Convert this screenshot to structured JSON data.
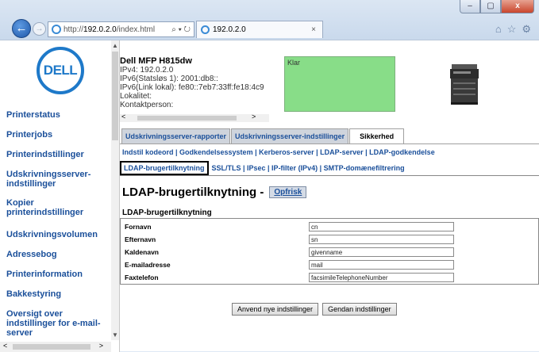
{
  "browser": {
    "url_prefix": "http://",
    "url_host": "192.0.2.0",
    "url_path": "/index.html",
    "addr_controls": "⌕ ▾ ↻",
    "tab_title": "192.0.2.0",
    "tab_close": "×",
    "back": "←",
    "forward": "→",
    "min": "–",
    "max": "▢",
    "close": "x",
    "home": "⌂",
    "star": "☆",
    "settings": "⚙"
  },
  "sidebar": {
    "logo": "DELL",
    "items": [
      "Printerstatus",
      "Printerjobs",
      "Printerindstillinger",
      "Udskrivningsserver-indstillinger",
      "Kopier printerindstillinger",
      "Udskrivningsvolumen",
      "Adressebog",
      "Printerinformation",
      "Bakkestyring",
      "Oversigt over indstillinger for e-mail-server"
    ]
  },
  "device": {
    "title": "Dell MFP H815dw",
    "lines": [
      "IPv4: 192.0.2.0",
      "IPv6(Statsløs 1): 2001:db8::",
      "IPv6(Link lokal): fe80::7eb7:33ff:fe18:4c9",
      "Lokalitet:",
      "Kontaktperson:"
    ],
    "status": "Klar"
  },
  "tabs": [
    "Udskrivningsserver-rapporter",
    "Udskrivningsserver-indstillinger",
    "Sikkerhed"
  ],
  "sublinks_row1": "Indstil kodeord | Godkendelsessystem | Kerberos-server | LDAP-server | LDAP-godkendelse",
  "sublinks_row2": {
    "current": "LDAP-brugertilknytning",
    "rest": "SSL/TLS | IPsec | IP-filter (IPv4) | SMTP-domænefiltrering"
  },
  "page": {
    "heading": "LDAP-brugertilknytning -",
    "refresh": "Opfrisk",
    "section": "LDAP-brugertilknytning"
  },
  "form": {
    "rows": [
      {
        "label": "Fornavn",
        "value": "cn"
      },
      {
        "label": "Efternavn",
        "value": "sn"
      },
      {
        "label": "Kaldenavn",
        "value": "givenname"
      },
      {
        "label": "E-mailadresse",
        "value": "mail"
      },
      {
        "label": "Faxtelefon",
        "value": "facsimileTelephoneNumber"
      }
    ]
  },
  "buttons": {
    "apply": "Anvend nye indstillinger",
    "reset": "Gendan indstillinger"
  }
}
